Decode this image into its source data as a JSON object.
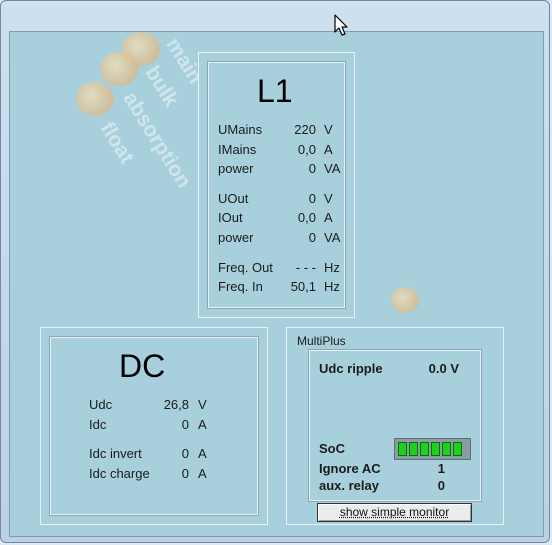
{
  "l1": {
    "title": "L1",
    "rows": [
      {
        "label": "UMains",
        "value": "220",
        "unit": "V"
      },
      {
        "label": "IMains",
        "value": "0,0",
        "unit": "A"
      },
      {
        "label": "power",
        "value": "0",
        "unit": "VA"
      },
      {
        "label": "UOut",
        "value": "0",
        "unit": "V"
      },
      {
        "label": "IOut",
        "value": "0,0",
        "unit": "A"
      },
      {
        "label": "power",
        "value": "0",
        "unit": "VA"
      },
      {
        "label": "Freq. Out",
        "value": "- - -",
        "unit": "Hz"
      },
      {
        "label": "Freq. In",
        "value": "50,1",
        "unit": "Hz"
      }
    ]
  },
  "dc": {
    "title": "DC",
    "rows": [
      {
        "label": "Udc",
        "value": "26,8",
        "unit": "V"
      },
      {
        "label": "Idc",
        "value": "0",
        "unit": "A"
      },
      {
        "label": "Idc invert",
        "value": "0",
        "unit": "A"
      },
      {
        "label": "Idc charge",
        "value": "0",
        "unit": "A"
      }
    ]
  },
  "multiplus": {
    "group_label": "MultiPlus",
    "udc_ripple_label": "Udc ripple",
    "udc_ripple_value": "0.0 V",
    "soc_label": "SoC",
    "soc_cells": 6,
    "ignore_ac_label": "Ignore AC",
    "ignore_ac_value": "1",
    "aux_relay_label": "aux. relay",
    "aux_relay_value": "0",
    "button_label": "show simple monitor"
  },
  "watermark": {
    "words": [
      "main",
      "bulk",
      "absorption",
      "float"
    ]
  },
  "colors": {
    "client_bg": "#a8d0dc",
    "soc_green": "#1fd11f"
  }
}
